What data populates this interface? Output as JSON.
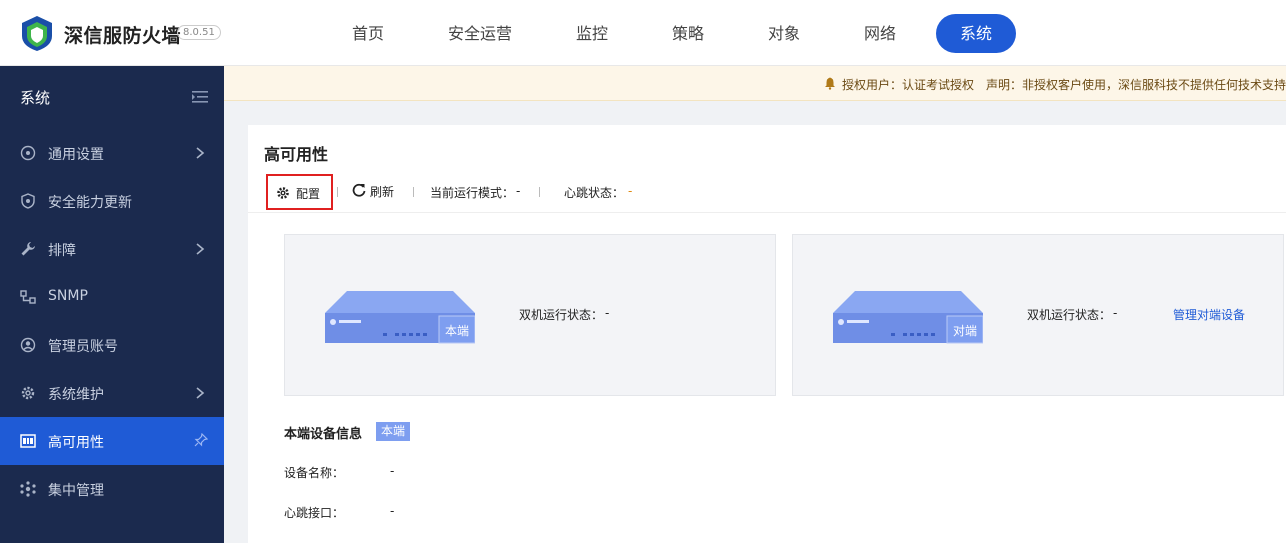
{
  "header": {
    "brand": "深信服防火墙",
    "version": "8.0.51",
    "nav": [
      {
        "label": "首页",
        "active": false
      },
      {
        "label": "安全运营",
        "active": false
      },
      {
        "label": "监控",
        "active": false
      },
      {
        "label": "策略",
        "active": false
      },
      {
        "label": "对象",
        "active": false
      },
      {
        "label": "网络",
        "active": false
      },
      {
        "label": "系统",
        "active": true
      }
    ]
  },
  "sidebar": {
    "title": "系统",
    "items": [
      {
        "label": "通用设置",
        "icon": "settings-circle-icon",
        "has_arrow": true
      },
      {
        "label": "安全能力更新",
        "icon": "shield-icon",
        "has_arrow": false
      },
      {
        "label": "排障",
        "icon": "wrench-icon",
        "has_arrow": true
      },
      {
        "label": "SNMP",
        "icon": "snmp-icon",
        "has_arrow": false
      },
      {
        "label": "管理员账号",
        "icon": "user-icon",
        "has_arrow": false
      },
      {
        "label": "系统维护",
        "icon": "gear-icon",
        "has_arrow": true
      },
      {
        "label": "高可用性",
        "icon": "ha-icon",
        "active": true
      },
      {
        "label": "集中管理",
        "icon": "cluster-icon",
        "has_arrow": false
      }
    ]
  },
  "notice": {
    "text": "授权用户：认证考试授权　声明：非授权客户使用，深信服科技不提供任何技术支持"
  },
  "main": {
    "title": "高可用性",
    "toolbar": {
      "config_label": "配置",
      "refresh_label": "刷新",
      "mode_label": "当前运行模式：",
      "mode_value": "-",
      "heartbeat_label": "心跳状态：",
      "heartbeat_value": "-"
    },
    "local_panel": {
      "device_tag": "本端",
      "status_label": "双机运行状态：",
      "status_value": "-"
    },
    "peer_panel": {
      "device_tag": "对端",
      "status_label": "双机运行状态：",
      "status_value": "-",
      "link": "管理对端设备"
    },
    "info": {
      "title": "本端设备信息",
      "badge": "本端",
      "rows": [
        {
          "label": "设备名称：",
          "value": "-"
        },
        {
          "label": "心跳接口：",
          "value": "-"
        }
      ]
    }
  },
  "colors": {
    "accent": "#1f5bd6",
    "sidebar_bg": "#1b2a4e",
    "highlight_border": "#e02020",
    "device_blue": "#7e9ef0"
  }
}
